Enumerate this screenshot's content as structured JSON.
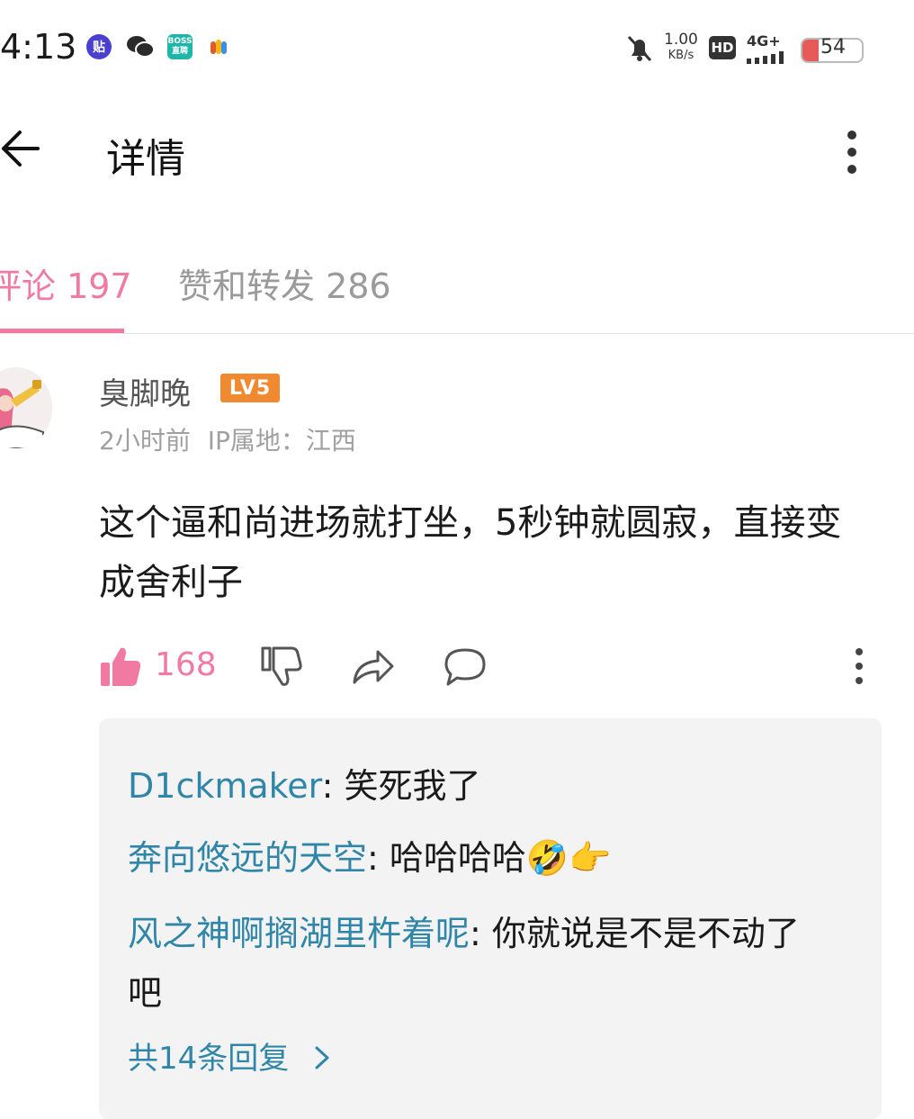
{
  "status_bar": {
    "time": "4:13",
    "apps": [
      {
        "icon": "tieba-app-icon",
        "label": "贴",
        "color": "#4b3fd0"
      },
      {
        "icon": "wechat-app-icon",
        "label": "",
        "color": "#2a2a2a"
      },
      {
        "icon": "boss-zhipin-app-icon",
        "label": "BOSS直聘",
        "color": "#1fb5a8"
      },
      {
        "icon": "colorful-app-icon",
        "label": "",
        "color": "#e05a2a"
      }
    ],
    "speed_value": "1.00",
    "speed_unit": "KB/s",
    "hd_label": "HD",
    "network": "4G+",
    "battery": "54"
  },
  "header": {
    "title": "详情"
  },
  "tabs": [
    {
      "label": "评论 197",
      "active": true
    },
    {
      "label": "赞和转发 286",
      "active": false
    }
  ],
  "comment": {
    "username": "臭脚晚",
    "level": "LV5",
    "time": "2小时前",
    "ip": "IP属地：江西",
    "text": "这个逼和尚进场就打坐，5秒钟就圆寂，直接变成舍利子",
    "likes": "168"
  },
  "replies": [
    {
      "name": "D1ckmaker",
      "text": ": 笑死我了"
    },
    {
      "name": "奔向悠远的天空",
      "text": ": 哈哈哈哈🤣👉"
    },
    {
      "name": "风之神啊搁湖里杵着呢",
      "text": ": 你就说是不是不动了吧"
    }
  ],
  "reply_more": "共14条回复",
  "colors": {
    "accent": "#f07aa2",
    "link": "#2f86a8",
    "level_badge": "#f08a30"
  }
}
